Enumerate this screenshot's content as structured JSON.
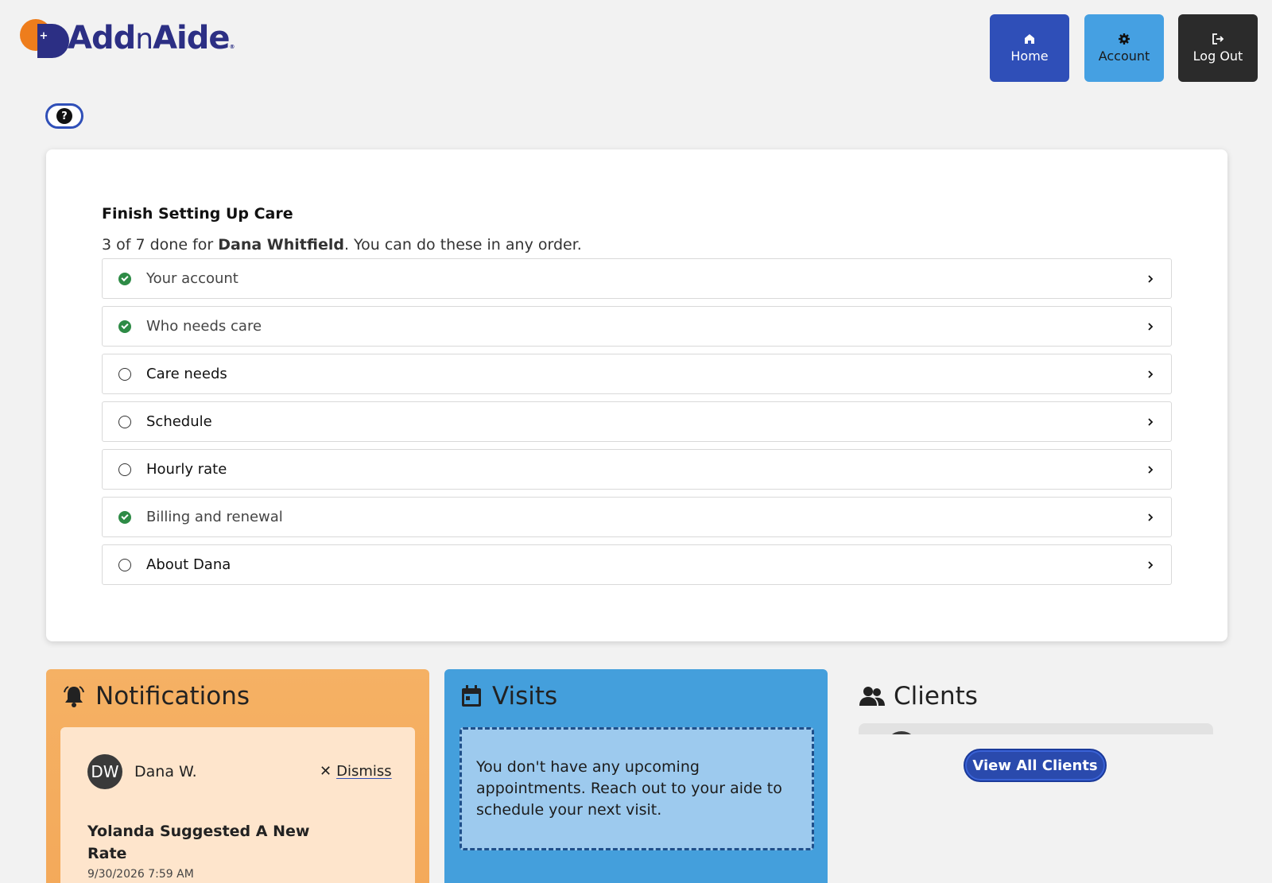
{
  "brand": {
    "name_part1": "Add",
    "name_part2": "n",
    "name_part3": "Aide",
    "trademark": "®",
    "logo_plus": "+"
  },
  "nav": {
    "home_label": "Home",
    "account_label": "Account",
    "logout_label": "Log Out"
  },
  "help": {
    "label": "?"
  },
  "setup": {
    "title": "Finish Setting Up Care",
    "progress_prefix": "3 of 7 done for ",
    "client_name": "Dana Whitfield",
    "progress_suffix": ". You can do these in any order.",
    "steps": [
      {
        "label": "Your account",
        "done": true
      },
      {
        "label": "Who needs care",
        "done": true
      },
      {
        "label": "Care needs",
        "done": false
      },
      {
        "label": "Schedule",
        "done": false
      },
      {
        "label": "Hourly rate",
        "done": false
      },
      {
        "label": "Billing and renewal",
        "done": true
      },
      {
        "label": "About Dana",
        "done": false
      }
    ]
  },
  "notifications": {
    "title": "Notifications",
    "item": {
      "avatar_initials": "DW",
      "name": "Dana W.",
      "dismiss_label": "Dismiss",
      "message": "Yolanda Suggested A New Rate",
      "timestamp": "9/30/2026 7:59 AM"
    }
  },
  "visits": {
    "title": "Visits",
    "empty_message": "You don't have any upcoming appointments. Reach out to your aide to schedule your next visit."
  },
  "clients": {
    "title": "Clients",
    "view_all_label": "View All Clients"
  },
  "colors": {
    "home": "#2f4fb8",
    "account": "#45a0e2",
    "logout": "#2b2b2b",
    "done": "#2e8b46",
    "notifications": "#f4a95a",
    "visits": "#449fdc"
  }
}
